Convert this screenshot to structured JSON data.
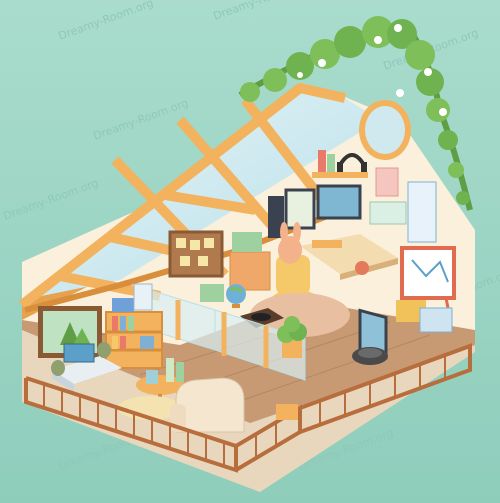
{
  "watermark": {
    "text": "Dreamy-Room.org",
    "color": "#8fc8ba"
  },
  "colors": {
    "background_top": "#a9dccd",
    "background_bottom": "#8fcdbb",
    "wall": "#fbf0dc",
    "wood_beam": "#f2b25e",
    "wood_beam_dark": "#d98e3c",
    "glass": "#cfe9ef",
    "floor": "#c89a74",
    "floor_dark": "#a97a58",
    "railing": "#b86d3c",
    "plant": "#7fbf5a",
    "plant_dark": "#5f9e44"
  },
  "scene": {
    "items": [
      "attic-window-roof",
      "ivy-plant",
      "round-window",
      "desk",
      "computer-monitors",
      "gaming-chair",
      "bunny-plush",
      "bookshelf",
      "tv-console",
      "side-table",
      "armchair",
      "whiteboard",
      "robot-vacuum",
      "globe",
      "record-player",
      "balcony-railing",
      "glass-partition",
      "headphones"
    ]
  }
}
